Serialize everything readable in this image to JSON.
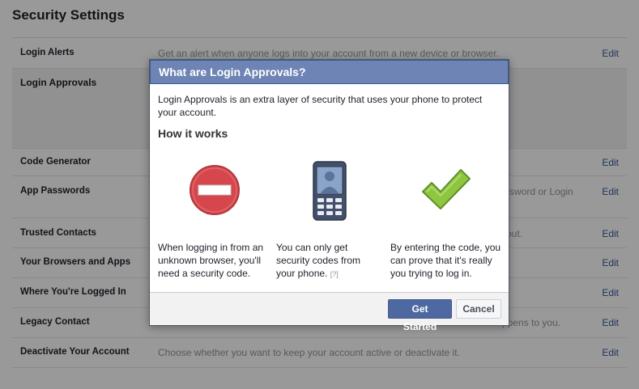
{
  "page": {
    "title": "Security Settings"
  },
  "settings": [
    {
      "name": "Login Alerts",
      "desc": "Get an alert when anyone logs into your account from a new device or browser.",
      "edit": "Edit"
    },
    {
      "name": "Login Approvals",
      "desc": "",
      "edit": ""
    },
    {
      "name": "Code Generator",
      "desc": "",
      "edit": "Edit"
    },
    {
      "name": "App Passwords",
      "desc": "ssword or Login",
      "edit": "Edit"
    },
    {
      "name": "Trusted Contacts",
      "desc": "out.",
      "edit": "Edit"
    },
    {
      "name": "Your Browsers and Apps",
      "desc": "",
      "edit": "Edit"
    },
    {
      "name": "Where You're Logged In",
      "desc": "",
      "edit": "Edit"
    },
    {
      "name": "Legacy Contact",
      "desc": "ppens to you.",
      "edit": "Edit"
    },
    {
      "name": "Deactivate Your Account",
      "desc": "Choose whether you want to keep your account active or deactivate it.",
      "edit": "Edit"
    }
  ],
  "dialog": {
    "title": "What are Login Approvals?",
    "intro": "Login Approvals is an extra layer of security that uses your phone to protect your account.",
    "subhead": "How it works",
    "columns": [
      {
        "icon": "no-entry-icon",
        "text": "When logging in from an unknown browser, you'll need a security code."
      },
      {
        "icon": "mobile-phone-icon",
        "text": "You can only get security codes from your phone.",
        "help": "[?]"
      },
      {
        "icon": "checkmark-icon",
        "text": "By entering the code, you can prove that it's really you trying to log in."
      }
    ],
    "buttons": {
      "primary": "Get Started",
      "secondary": "Cancel"
    }
  },
  "colors": {
    "dialog_header": "#6d84b4",
    "link": "#365899",
    "primary_button": "#4e69a2",
    "stop_red": "#d6474d",
    "check_green": "#8ec63f"
  }
}
